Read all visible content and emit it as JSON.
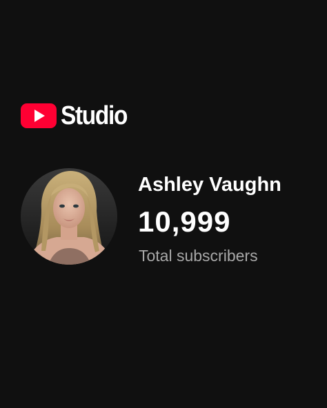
{
  "brand": {
    "logo_icon": "youtube-play-logo-icon",
    "name": "Studio",
    "logo_color": "#ff0033"
  },
  "channel": {
    "avatar_icon": "channel-avatar-photo",
    "name": "Ashley Vaughn",
    "subscriber_count": "10,999",
    "subscriber_label": "Total subscribers"
  },
  "colors": {
    "background": "#101010",
    "primary_text": "#ffffff",
    "secondary_text": "#a8a8a8"
  }
}
